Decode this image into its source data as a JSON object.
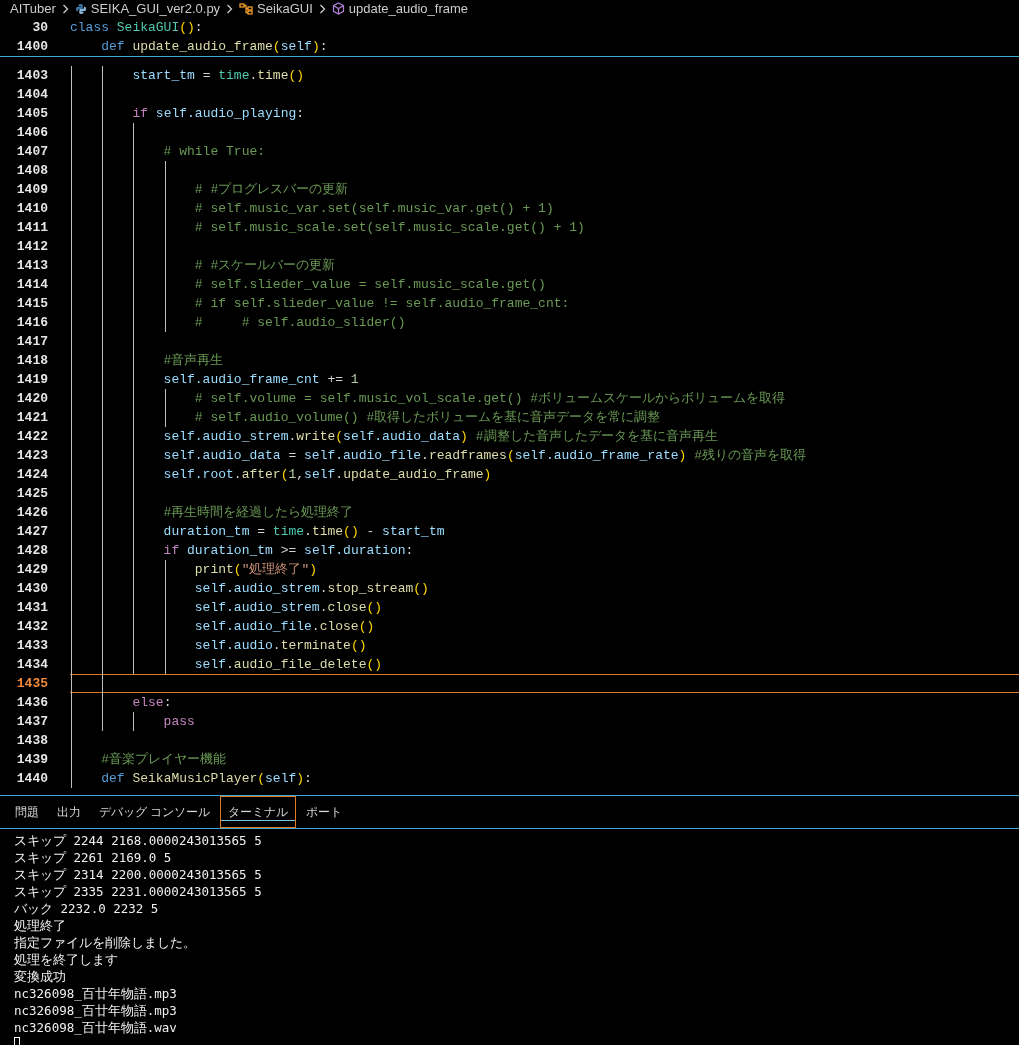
{
  "breadcrumb": [
    {
      "kind": "folder",
      "label": "AITuber"
    },
    {
      "kind": "python-file",
      "label": "SEIKA_GUI_ver2.0.py"
    },
    {
      "kind": "class",
      "label": "SeikaGUI"
    },
    {
      "kind": "method",
      "label": "update_audio_frame"
    }
  ],
  "sticky_lines": [
    {
      "number": "30",
      "code": [
        {
          "kind": "kw",
          "text": "class "
        },
        {
          "kind": "cls",
          "text": "SeikaGUI"
        },
        {
          "kind": "p1",
          "text": "()"
        },
        {
          "kind": "op",
          "text": ":"
        }
      ]
    },
    {
      "number": "1400",
      "code": [
        {
          "kind": "kw",
          "text": "    def "
        },
        {
          "kind": "fn",
          "text": "update_audio_frame"
        },
        {
          "kind": "p1",
          "text": "("
        },
        {
          "kind": "var",
          "text": "self"
        },
        {
          "kind": "p1",
          "text": ")"
        },
        {
          "kind": "op",
          "text": ":"
        }
      ]
    }
  ],
  "lines": [
    {
      "number": "1403",
      "current": false,
      "code": [
        {
          "kind": "var",
          "text": "        start_tm"
        },
        {
          "kind": "op",
          "text": " = "
        },
        {
          "kind": "cls",
          "text": "time"
        },
        {
          "kind": "op",
          "text": "."
        },
        {
          "kind": "fn",
          "text": "time"
        },
        {
          "kind": "p1",
          "text": "()"
        }
      ]
    },
    {
      "number": "1404",
      "current": false
    },
    {
      "number": "1405",
      "current": false,
      "code": [
        {
          "kind": "ctl",
          "text": "        if "
        },
        {
          "kind": "var",
          "text": "self.audio_playing"
        },
        {
          "kind": "op",
          "text": ":"
        }
      ]
    },
    {
      "number": "1406",
      "current": false
    },
    {
      "number": "1407",
      "current": false,
      "code": [
        {
          "kind": "cm",
          "text": "            # while True:"
        }
      ]
    },
    {
      "number": "1408",
      "current": false
    },
    {
      "number": "1409",
      "current": false,
      "code": [
        {
          "kind": "cm",
          "text": "                # #プログレスバーの更新"
        }
      ]
    },
    {
      "number": "1410",
      "current": false,
      "code": [
        {
          "kind": "cm",
          "text": "                # self.music_var.set(self.music_var.get() + 1)"
        }
      ]
    },
    {
      "number": "1411",
      "current": false,
      "code": [
        {
          "kind": "cm",
          "text": "                # self.music_scale.set(self.music_scale.get() + 1)"
        }
      ]
    },
    {
      "number": "1412",
      "current": false
    },
    {
      "number": "1413",
      "current": false,
      "code": [
        {
          "kind": "cm",
          "text": "                # #スケールバーの更新"
        }
      ]
    },
    {
      "number": "1414",
      "current": false,
      "code": [
        {
          "kind": "cm",
          "text": "                # self.slieder_value = self.music_scale.get()"
        }
      ]
    },
    {
      "number": "1415",
      "current": false,
      "code": [
        {
          "kind": "cm",
          "text": "                # if self.slieder_value != self.audio_frame_cnt:"
        }
      ]
    },
    {
      "number": "1416",
      "current": false,
      "code": [
        {
          "kind": "cm",
          "text": "                #     # self.audio_slider()"
        }
      ]
    },
    {
      "number": "1417",
      "current": false
    },
    {
      "number": "1418",
      "current": false,
      "code": [
        {
          "kind": "cm",
          "text": "            #音声再生"
        }
      ]
    },
    {
      "number": "1419",
      "current": false,
      "code": [
        {
          "kind": "var",
          "text": "            self.audio_frame_cnt"
        },
        {
          "kind": "op",
          "text": " += "
        },
        {
          "kind": "num",
          "text": "1"
        }
      ]
    },
    {
      "number": "1420",
      "current": false,
      "code": [
        {
          "kind": "cm",
          "text": "                # self.volume = self.music_vol_scale.get() #ボリュームスケールからボリュームを取得"
        }
      ]
    },
    {
      "number": "1421",
      "current": false,
      "code": [
        {
          "kind": "cm",
          "text": "                # self.audio_volume() #取得したボリュームを基に音声データを常に調整"
        }
      ]
    },
    {
      "number": "1422",
      "current": false,
      "code": [
        {
          "kind": "var",
          "text": "            self.audio_strem"
        },
        {
          "kind": "op",
          "text": "."
        },
        {
          "kind": "fn",
          "text": "write"
        },
        {
          "kind": "p1",
          "text": "("
        },
        {
          "kind": "var",
          "text": "self.audio_data"
        },
        {
          "kind": "p1",
          "text": ")"
        },
        {
          "kind": "cm",
          "text": " #調整した音声したデータを基に音声再生"
        }
      ]
    },
    {
      "number": "1423",
      "current": false,
      "code": [
        {
          "kind": "var",
          "text": "            self.audio_data"
        },
        {
          "kind": "op",
          "text": " = "
        },
        {
          "kind": "var",
          "text": "self.audio_file"
        },
        {
          "kind": "op",
          "text": "."
        },
        {
          "kind": "fn",
          "text": "readframes"
        },
        {
          "kind": "p1",
          "text": "("
        },
        {
          "kind": "var",
          "text": "self.audio_frame_rate"
        },
        {
          "kind": "p1",
          "text": ")"
        },
        {
          "kind": "cm",
          "text": " #残りの音声を取得"
        }
      ]
    },
    {
      "number": "1424",
      "current": false,
      "code": [
        {
          "kind": "var",
          "text": "            self.root"
        },
        {
          "kind": "op",
          "text": "."
        },
        {
          "kind": "fn",
          "text": "after"
        },
        {
          "kind": "p1",
          "text": "("
        },
        {
          "kind": "num",
          "text": "1"
        },
        {
          "kind": "op",
          "text": ","
        },
        {
          "kind": "var",
          "text": "self"
        },
        {
          "kind": "op",
          "text": "."
        },
        {
          "kind": "fn",
          "text": "update_audio_frame"
        },
        {
          "kind": "p1",
          "text": ")"
        }
      ]
    },
    {
      "number": "1425",
      "current": false
    },
    {
      "number": "1426",
      "current": false,
      "code": [
        {
          "kind": "cm",
          "text": "            #再生時間を経過したら処理終了"
        }
      ]
    },
    {
      "number": "1427",
      "current": false,
      "code": [
        {
          "kind": "var",
          "text": "            duration_tm"
        },
        {
          "kind": "op",
          "text": " = "
        },
        {
          "kind": "cls",
          "text": "time"
        },
        {
          "kind": "op",
          "text": "."
        },
        {
          "kind": "fn",
          "text": "time"
        },
        {
          "kind": "p1",
          "text": "()"
        },
        {
          "kind": "op",
          "text": " - "
        },
        {
          "kind": "var",
          "text": "start_tm"
        }
      ]
    },
    {
      "number": "1428",
      "current": false,
      "code": [
        {
          "kind": "ctl",
          "text": "            if "
        },
        {
          "kind": "var",
          "text": "duration_tm"
        },
        {
          "kind": "op",
          "text": " >= "
        },
        {
          "kind": "var",
          "text": "self.duration"
        },
        {
          "kind": "op",
          "text": ":"
        }
      ]
    },
    {
      "number": "1429",
      "current": false,
      "code": [
        {
          "kind": "fn",
          "text": "                print"
        },
        {
          "kind": "p1",
          "text": "("
        },
        {
          "kind": "str",
          "text": "\"処理終了\""
        },
        {
          "kind": "p1",
          "text": ")"
        }
      ]
    },
    {
      "number": "1430",
      "current": false,
      "code": [
        {
          "kind": "var",
          "text": "                self.audio_strem"
        },
        {
          "kind": "op",
          "text": "."
        },
        {
          "kind": "fn",
          "text": "stop_stream"
        },
        {
          "kind": "p1",
          "text": "()"
        }
      ]
    },
    {
      "number": "1431",
      "current": false,
      "code": [
        {
          "kind": "var",
          "text": "                self.audio_strem"
        },
        {
          "kind": "op",
          "text": "."
        },
        {
          "kind": "fn",
          "text": "close"
        },
        {
          "kind": "p1",
          "text": "()"
        }
      ]
    },
    {
      "number": "1432",
      "current": false,
      "code": [
        {
          "kind": "var",
          "text": "                self.audio_file"
        },
        {
          "kind": "op",
          "text": "."
        },
        {
          "kind": "fn",
          "text": "close"
        },
        {
          "kind": "p1",
          "text": "()"
        }
      ]
    },
    {
      "number": "1433",
      "current": false,
      "code": [
        {
          "kind": "var",
          "text": "                self.audio"
        },
        {
          "kind": "op",
          "text": "."
        },
        {
          "kind": "fn",
          "text": "terminate"
        },
        {
          "kind": "p1",
          "text": "()"
        }
      ]
    },
    {
      "number": "1434",
      "current": false,
      "code": [
        {
          "kind": "var",
          "text": "                self"
        },
        {
          "kind": "op",
          "text": "."
        },
        {
          "kind": "fn",
          "text": "audio_file_delete"
        },
        {
          "kind": "p1",
          "text": "()"
        }
      ]
    },
    {
      "number": "1435",
      "current": true
    },
    {
      "number": "1436",
      "current": false,
      "code": [
        {
          "kind": "ctl",
          "text": "        else"
        },
        {
          "kind": "op",
          "text": ":"
        }
      ]
    },
    {
      "number": "1437",
      "current": false,
      "code": [
        {
          "kind": "ctl",
          "text": "            pass"
        }
      ]
    },
    {
      "number": "1438",
      "current": false
    },
    {
      "number": "1439",
      "current": false,
      "code": [
        {
          "kind": "cm",
          "text": "    #音楽プレイヤー機能"
        }
      ]
    },
    {
      "number": "1440",
      "current": false,
      "code": [
        {
          "kind": "kw",
          "text": "    def "
        },
        {
          "kind": "fn",
          "text": "SeikaMusicPlayer"
        },
        {
          "kind": "p1",
          "text": "("
        },
        {
          "kind": "var",
          "text": "self"
        },
        {
          "kind": "p1",
          "text": ")"
        },
        {
          "kind": "op",
          "text": ":"
        }
      ]
    }
  ],
  "panel_tabs": [
    {
      "label": "問題",
      "selected": false
    },
    {
      "label": "出力",
      "selected": false
    },
    {
      "label": "デバッグ コンソール",
      "selected": false
    },
    {
      "label": "ターミナル",
      "selected": true
    },
    {
      "label": "ポート",
      "selected": false
    }
  ],
  "terminal_output": [
    "スキップ 2244 2168.0000243013565 5",
    "スキップ 2261 2169.0 5",
    "スキップ 2314 2200.0000243013565 5",
    "スキップ 2335 2231.0000243013565 5",
    "バック 2232.0 2232 5",
    "処理終了",
    "指定ファイルを削除しました。",
    "処理を終了します",
    "変換成功",
    "nc326098_百廿年物語.mp3",
    "nc326098_百廿年物語.mp3",
    "nc326098_百廿年物語.wav"
  ]
}
